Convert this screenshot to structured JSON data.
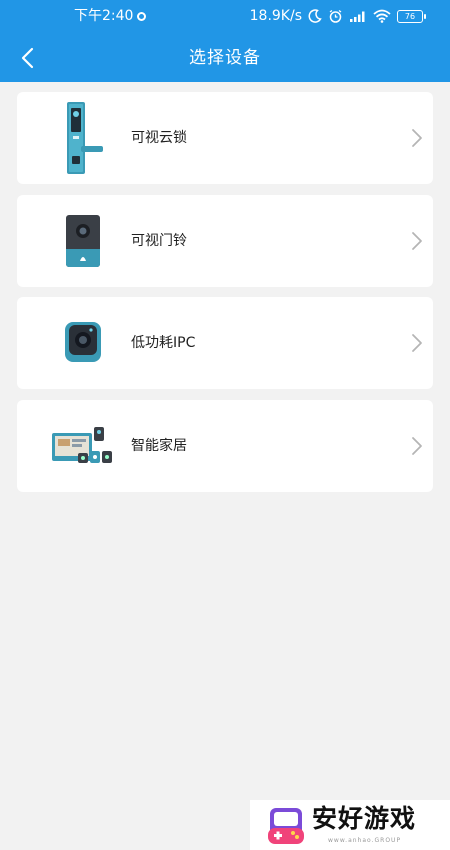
{
  "status_bar": {
    "time": "下午2:40",
    "net_speed": "18.9K/s",
    "battery": "76"
  },
  "header": {
    "title": "选择设备"
  },
  "devices": [
    {
      "label": "可视云锁",
      "icon": "smart-lock-icon"
    },
    {
      "label": "可视门铃",
      "icon": "doorbell-icon"
    },
    {
      "label": "低功耗IPC",
      "icon": "ipc-camera-icon"
    },
    {
      "label": "智能家居",
      "icon": "smart-home-icon"
    }
  ],
  "watermark": {
    "text": "安好游戏",
    "sub": "www.anhao.GROUP"
  },
  "colors": {
    "accent": "#2196e6",
    "background": "#f2f2f2",
    "device_teal": "#3a9ab5"
  }
}
